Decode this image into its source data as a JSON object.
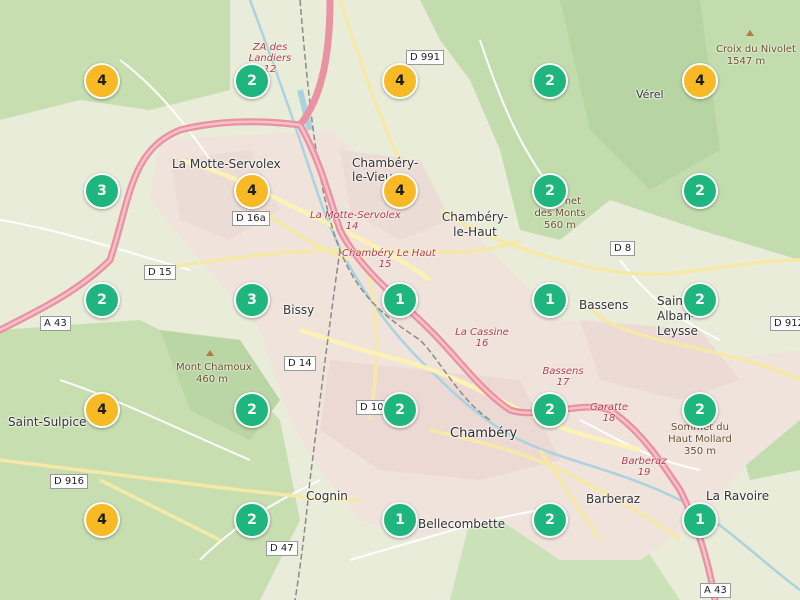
{
  "map": {
    "colors": {
      "cluster_green": "#1fb57f",
      "cluster_yellow": "#f7b924",
      "motorway": "#e892a2",
      "urban": "#f1e2e2"
    },
    "places": [
      {
        "id": "la-motte-servolex",
        "text": "La Motte-Servolex"
      },
      {
        "id": "chambery-le-vieux",
        "text": "Chambéry-le-Vieux"
      },
      {
        "id": "chambery-le-haut",
        "text": "Chambéry-le-Haut"
      },
      {
        "id": "bissy",
        "text": "Bissy"
      },
      {
        "id": "bassens",
        "text": "Bassens"
      },
      {
        "id": "saint-sulpice",
        "text": "Saint-Sulpice"
      },
      {
        "id": "chambery",
        "text": "Chambéry"
      },
      {
        "id": "cognin",
        "text": "Cognin"
      },
      {
        "id": "bellecombette",
        "text": "Bellecombette"
      },
      {
        "id": "barberaz",
        "text": "Barberaz"
      },
      {
        "id": "la-ravoire",
        "text": "La Ravoire"
      },
      {
        "id": "verel",
        "text": "Vérel"
      },
      {
        "id": "saint-alban-leysse",
        "text": "Saint-Alban-Leysse"
      }
    ],
    "roads": [
      "D 991",
      "D 16a",
      "D 15",
      "A 43",
      "D 14",
      "D 10",
      "D 8",
      "D 912",
      "D 916",
      "D 47",
      "A 43"
    ],
    "peaks": [
      {
        "name": "Croix du Nivolet",
        "elev": "1547 m"
      },
      {
        "name": "Sommet des Monts",
        "elev": "560 m"
      },
      {
        "name": "Mont Chamoux",
        "elev": "460 m"
      },
      {
        "name": "Sommet du Haut Mollard",
        "elev": "350 m"
      }
    ],
    "exits": [
      {
        "name": "ZA des Landiers",
        "num": "12"
      },
      {
        "name": "La Motte-Servolex",
        "num": "14"
      },
      {
        "name": "Chambéry Le Haut",
        "num": "15"
      },
      {
        "name": "La Cassine",
        "num": "16"
      },
      {
        "name": "Bassens",
        "num": "17"
      },
      {
        "name": "Garatte",
        "num": "18"
      },
      {
        "name": "Barberaz",
        "num": "19"
      }
    ],
    "clusters": [
      {
        "count": 4,
        "level": "yellow"
      },
      {
        "count": 2,
        "level": "green"
      },
      {
        "count": 4,
        "level": "yellow"
      },
      {
        "count": 2,
        "level": "green"
      },
      {
        "count": 4,
        "level": "yellow"
      },
      {
        "count": 3,
        "level": "green"
      },
      {
        "count": 4,
        "level": "yellow"
      },
      {
        "count": 4,
        "level": "yellow"
      },
      {
        "count": 2,
        "level": "green"
      },
      {
        "count": 2,
        "level": "green"
      },
      {
        "count": 2,
        "level": "green"
      },
      {
        "count": 3,
        "level": "green"
      },
      {
        "count": 1,
        "level": "green"
      },
      {
        "count": 1,
        "level": "green"
      },
      {
        "count": 2,
        "level": "green"
      },
      {
        "count": 4,
        "level": "yellow"
      },
      {
        "count": 2,
        "level": "green"
      },
      {
        "count": 2,
        "level": "green"
      },
      {
        "count": 2,
        "level": "green"
      },
      {
        "count": 2,
        "level": "green"
      },
      {
        "count": 4,
        "level": "yellow"
      },
      {
        "count": 2,
        "level": "green"
      },
      {
        "count": 1,
        "level": "green"
      },
      {
        "count": 2,
        "level": "green"
      },
      {
        "count": 1,
        "level": "green"
      }
    ]
  }
}
